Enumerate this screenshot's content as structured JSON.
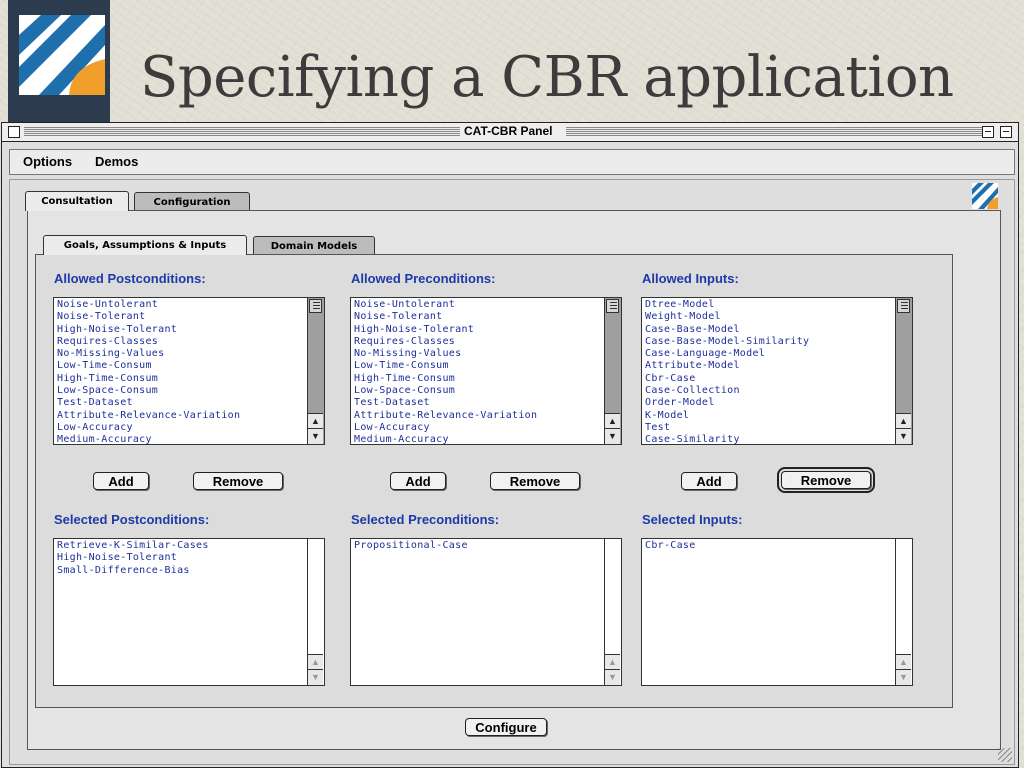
{
  "slide": {
    "title": "Specifying a CBR application",
    "logo_icon": "diagonal-stripes-logo",
    "colors": {
      "logo_blue": "#1f6fad",
      "logo_orange": "#f0a02a",
      "logo_frame": "#2c3b4d",
      "title": "#3c3c3c"
    }
  },
  "window": {
    "title": "CAT-CBR Panel",
    "menus": [
      "Options",
      "Demos"
    ]
  },
  "tabs": {
    "top": [
      {
        "label": "Consultation",
        "active": true
      },
      {
        "label": "Configuration",
        "active": false
      }
    ],
    "sub": [
      {
        "label": "Goals, Assumptions & Inputs",
        "active": true
      },
      {
        "label": "Domain Models",
        "active": false
      }
    ]
  },
  "columns": [
    {
      "allowed_label": "Allowed Postconditions:",
      "allowed_items": [
        "Noise-Untolerant",
        "Noise-Tolerant",
        "High-Noise-Tolerant",
        "Requires-Classes",
        "No-Missing-Values",
        "Low-Time-Consum",
        "High-Time-Consum",
        "Low-Space-Consum",
        "Test-Dataset",
        "Attribute-Relevance-Variation",
        "Low-Accuracy",
        "Medium-Accuracy"
      ],
      "add_label": "Add",
      "remove_label": "Remove",
      "selected_label": "Selected Postconditions:",
      "selected_items": [
        "Retrieve-K-Similar-Cases",
        "High-Noise-Tolerant",
        "Small-Difference-Bias"
      ]
    },
    {
      "allowed_label": "Allowed Preconditions:",
      "allowed_items": [
        "Noise-Untolerant",
        "Noise-Tolerant",
        "High-Noise-Tolerant",
        "Requires-Classes",
        "No-Missing-Values",
        "Low-Time-Consum",
        "High-Time-Consum",
        "Low-Space-Consum",
        "Test-Dataset",
        "Attribute-Relevance-Variation",
        "Low-Accuracy",
        "Medium-Accuracy"
      ],
      "add_label": "Add",
      "remove_label": "Remove",
      "selected_label": "Selected Preconditions:",
      "selected_items": [
        "Propositional-Case"
      ]
    },
    {
      "allowed_label": "Allowed Inputs:",
      "allowed_items": [
        "Dtree-Model",
        "Weight-Model",
        "Case-Base-Model",
        "Case-Base-Model-Similarity",
        "Case-Language-Model",
        "Attribute-Model",
        "Cbr-Case",
        "Case-Collection",
        "Order-Model",
        "K-Model",
        "Test",
        "Case-Similarity"
      ],
      "add_label": "Add",
      "remove_label": "Remove",
      "selected_label": "Selected Inputs:",
      "selected_items": [
        "Cbr-Case"
      ]
    }
  ],
  "configure_label": "Configure",
  "colors": {
    "list_text": "#1d2f9a",
    "section_label": "#1d3aa8",
    "window_bg": "#dedede"
  }
}
